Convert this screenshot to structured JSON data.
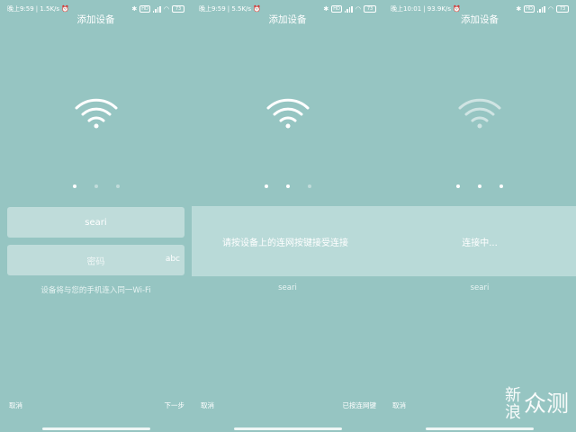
{
  "screens": [
    {
      "status_time": "晚上9:59",
      "status_speed": "1.5K/s",
      "title": "添加设备",
      "ssid_value": "seari",
      "password_placeholder": "密码",
      "keyboard_hint": "abc",
      "hint_text": "设备将与您的手机连入同一Wi-Fi",
      "left_button": "取消",
      "right_button": "下一步",
      "step": 1
    },
    {
      "status_time": "晚上9:59",
      "status_speed": "5.5K/s",
      "title": "添加设备",
      "banner_text": "请按设备上的连网按键接受连接",
      "ssid_text": "seari",
      "left_button": "取消",
      "right_button": "已按连网键",
      "step": 2
    },
    {
      "status_time": "晚上10:01",
      "status_speed": "93.9K/s",
      "title": "添加设备",
      "banner_text": "连接中...",
      "ssid_text": "seari",
      "left_button": "取消",
      "step": 3
    }
  ],
  "status_icons": [
    "alarm-icon",
    "bluetooth-icon",
    "hd-icon",
    "signal-icon",
    "wifi-icon",
    "battery-icon"
  ],
  "battery_text": "73",
  "watermark": {
    "line1": "新",
    "line2": "浪",
    "line3": "众测"
  },
  "colors": {
    "background": "#96c5c2",
    "field": "#bfdcda",
    "banner": "#b9dad8",
    "text": "#ffffff"
  }
}
